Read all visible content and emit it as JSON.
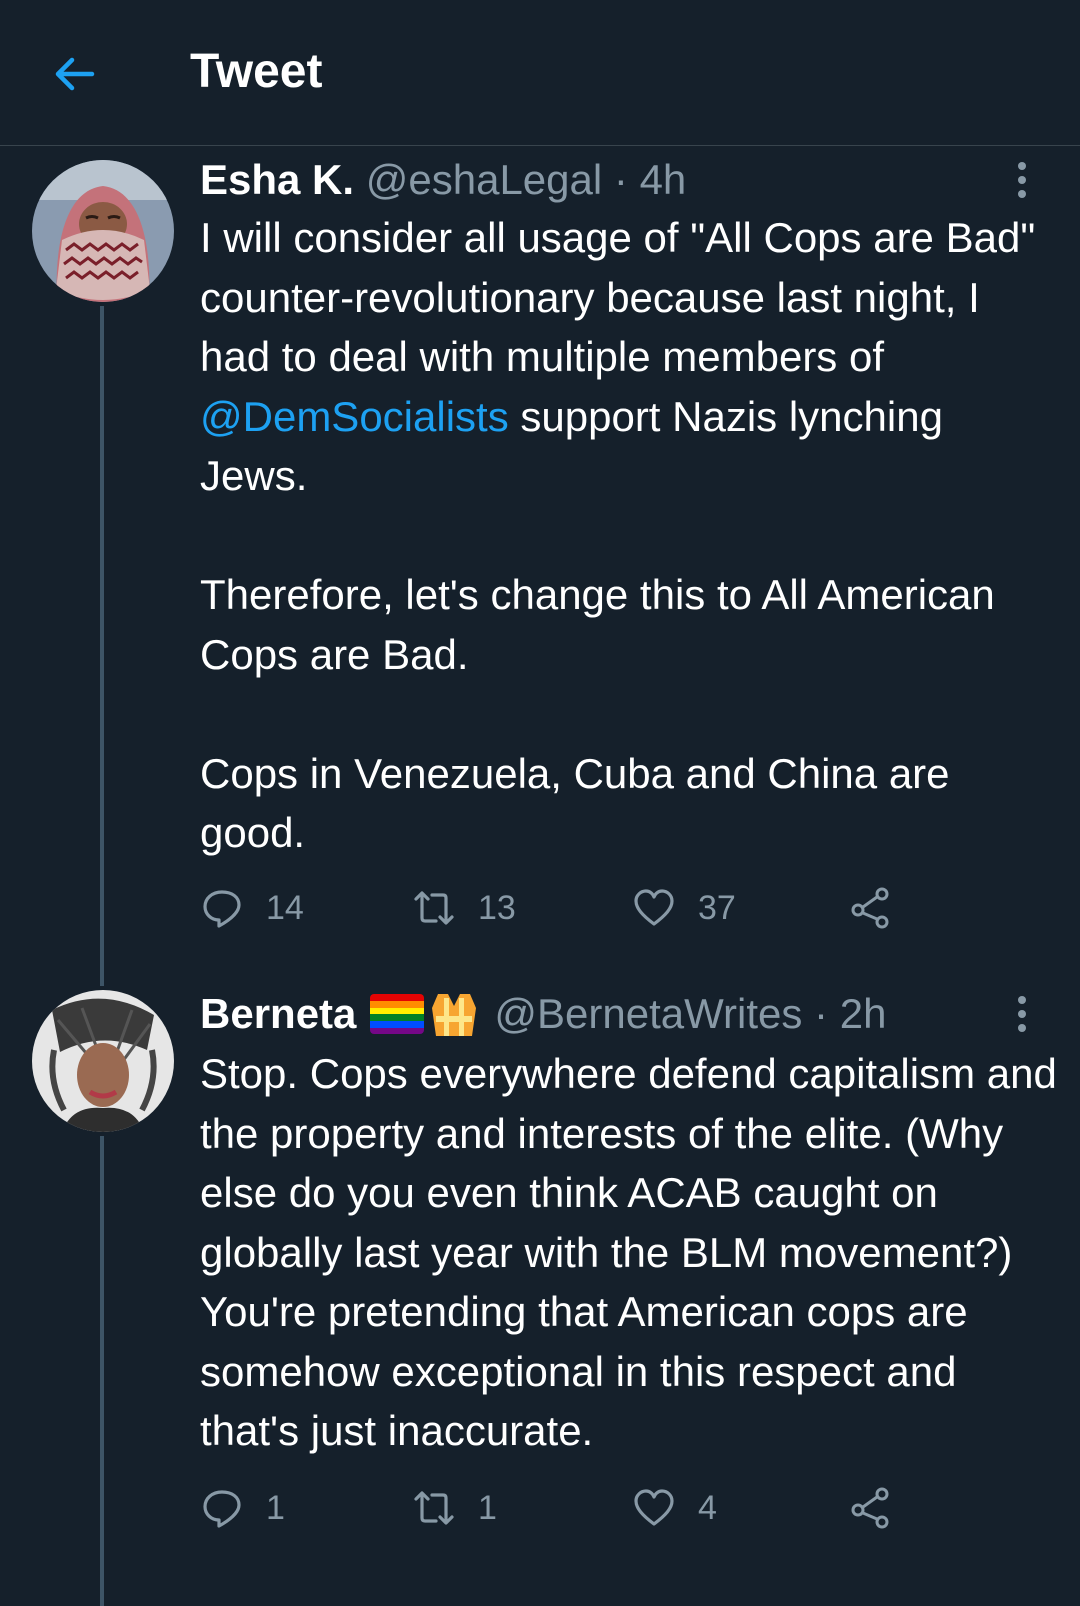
{
  "header": {
    "title": "Tweet"
  },
  "tweets": [
    {
      "name": "Esha K.",
      "handle": "@eshaLegal",
      "time": "4h",
      "body_1": "I will consider all usage of \"All Cops are Bad\" counter-revolutionary because last night, I had to deal with multiple members of ",
      "mention": "@DemSocialists",
      "body_2": " support Nazis lynching Jews.\n\nTherefore, let's change this to All American Cops are Bad.\n\nCops in Venezuela, Cuba and China are good.",
      "replies": "14",
      "retweets": "13",
      "likes": "37"
    },
    {
      "name": "Berneta",
      "handle": "@BernetaWrites",
      "time": "2h",
      "body": "Stop. Cops everywhere defend capitalism and the property and interests of the elite. (Why else do you even think ACAB caught on globally last year with the BLM movement?) You're pretending that American cops are somehow exceptional in this respect and that's just inaccurate.",
      "replies": "1",
      "retweets": "1",
      "likes": "4"
    }
  ],
  "meta": {
    "separator": "·",
    "accent": "#1da1f2",
    "background": "#15202b",
    "muted": "#8899a6",
    "icons": [
      "back-arrow-icon",
      "more-icon",
      "reply-icon",
      "retweet-icon",
      "like-icon",
      "share-icon",
      "rainbow-flag-icon",
      "safety-vest-icon"
    ]
  }
}
